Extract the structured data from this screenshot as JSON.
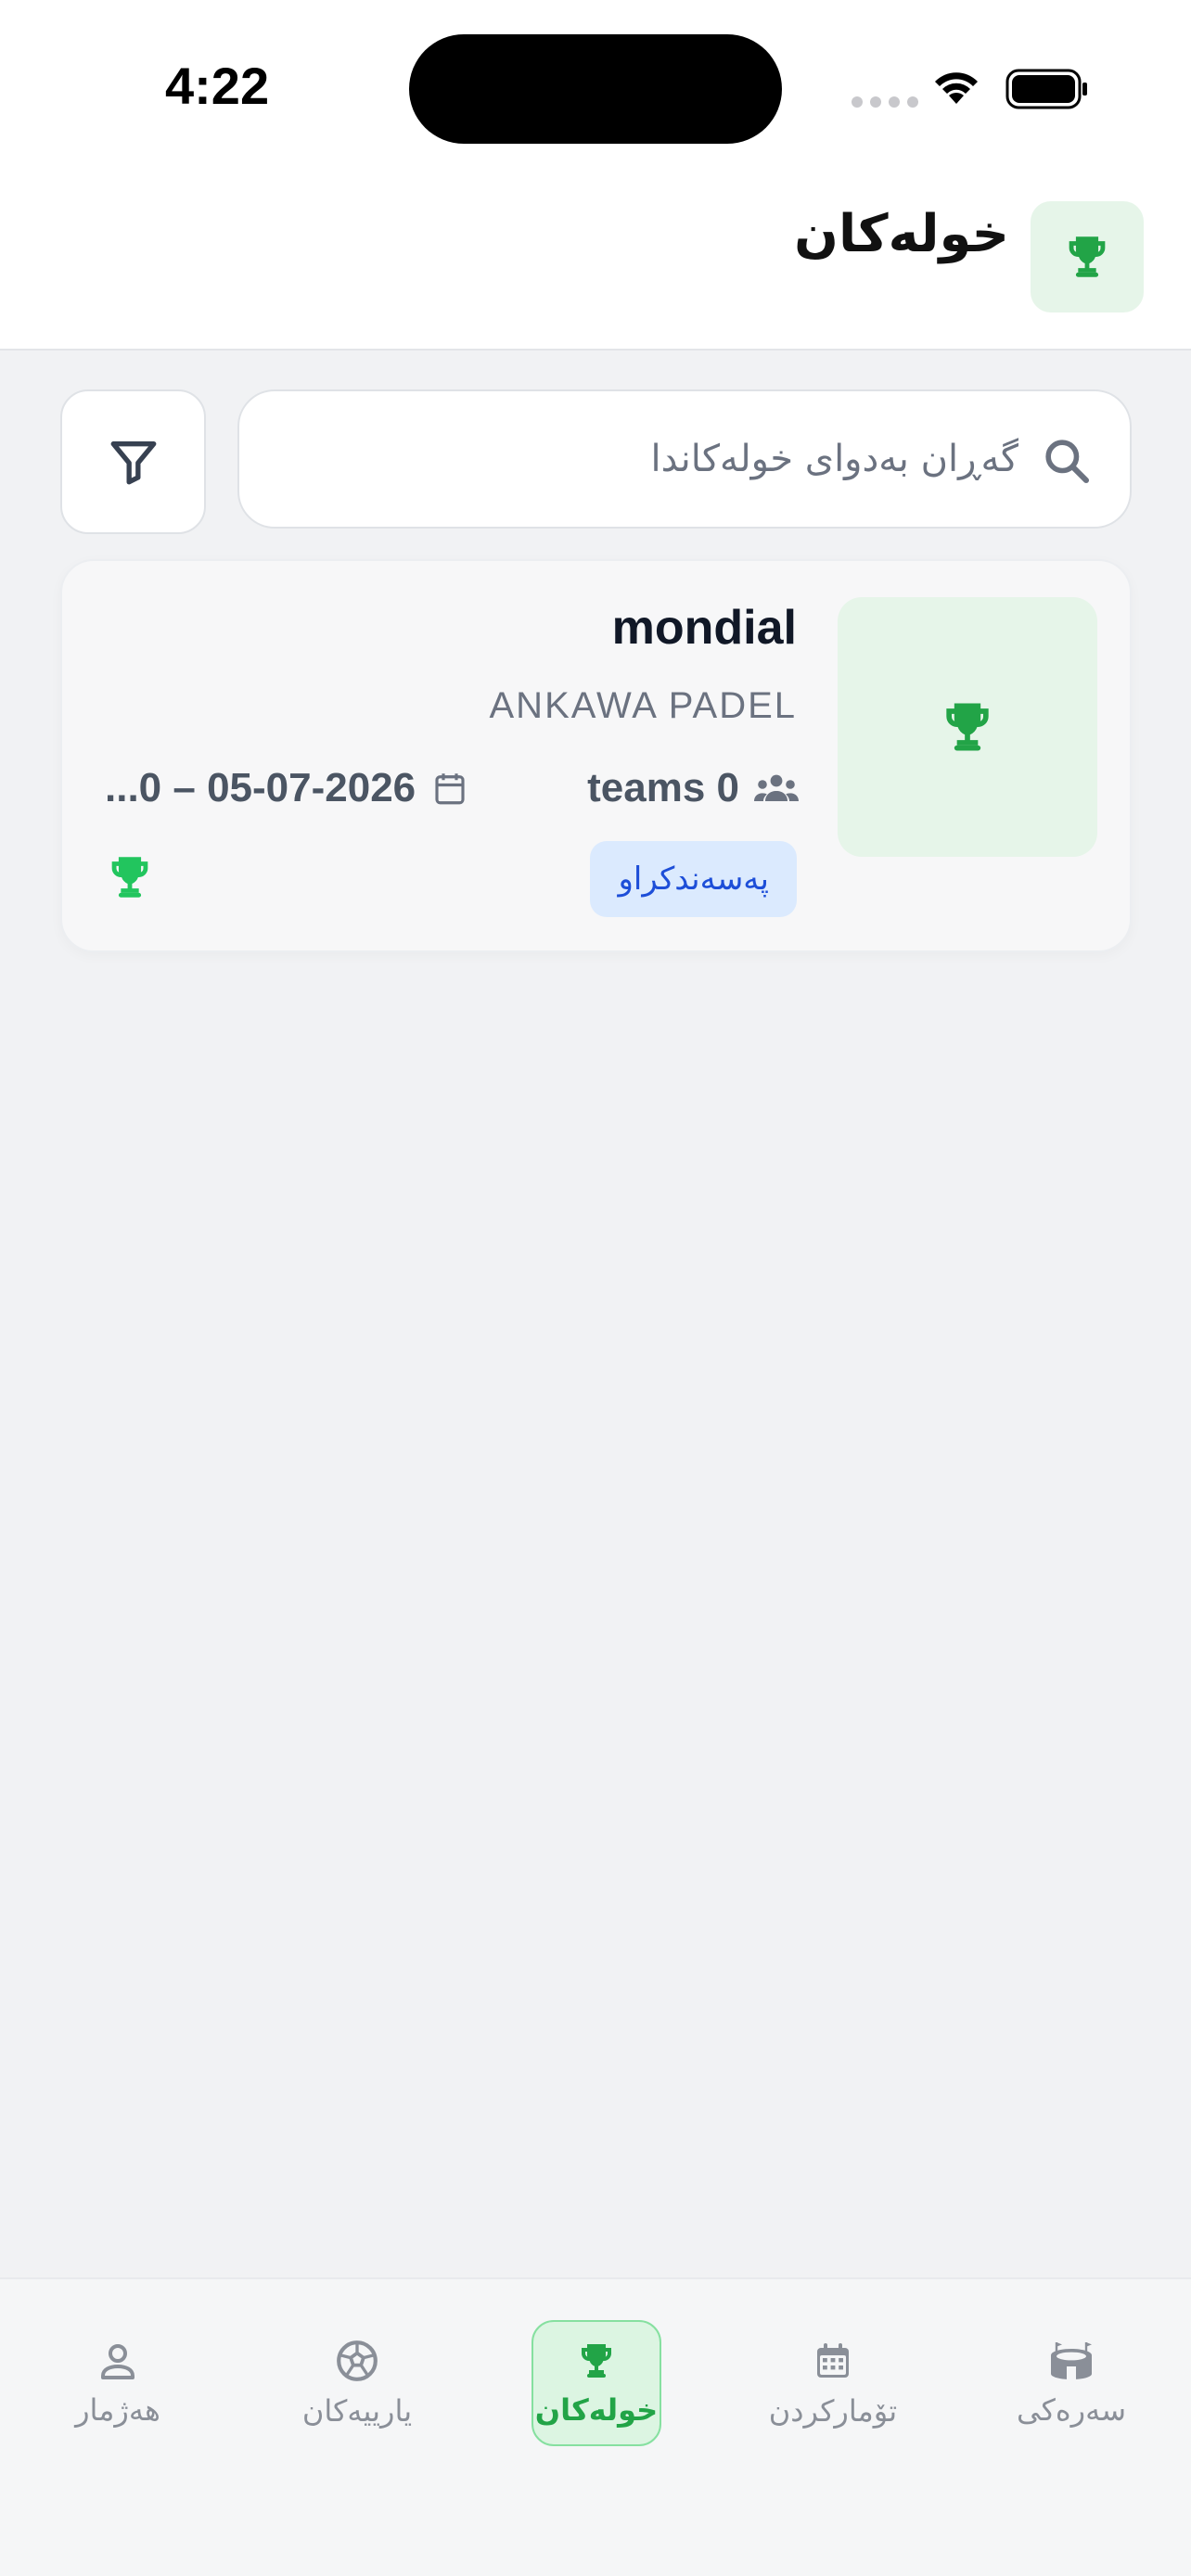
{
  "status_bar": {
    "time": "4:22"
  },
  "header": {
    "title": "خولەکان",
    "icon": "trophy-icon"
  },
  "search": {
    "placeholder": "گەڕان بەدوای خولەکاندا"
  },
  "tournaments": [
    {
      "name": "mondial",
      "venue": "ANKAWA PADEL",
      "teams": "teams 0",
      "dates": "...0 – 05-07-2026",
      "status": "پەسەندکراو"
    }
  ],
  "tabbar": {
    "items": [
      {
        "label": "سەرەکی",
        "icon": "stadium-icon",
        "active": false
      },
      {
        "label": "تۆمارکردن",
        "icon": "calendar-icon",
        "active": false
      },
      {
        "label": "خولەکان",
        "icon": "trophy-icon",
        "active": true
      },
      {
        "label": "یارییەکان",
        "icon": "soccer-ball-icon",
        "active": false
      },
      {
        "label": "هەژمار",
        "icon": "person-icon",
        "active": false
      }
    ]
  },
  "colors": {
    "accent_green": "#22a447",
    "badge_blue": "#1d4ed8",
    "background": "#f1f2f4"
  }
}
